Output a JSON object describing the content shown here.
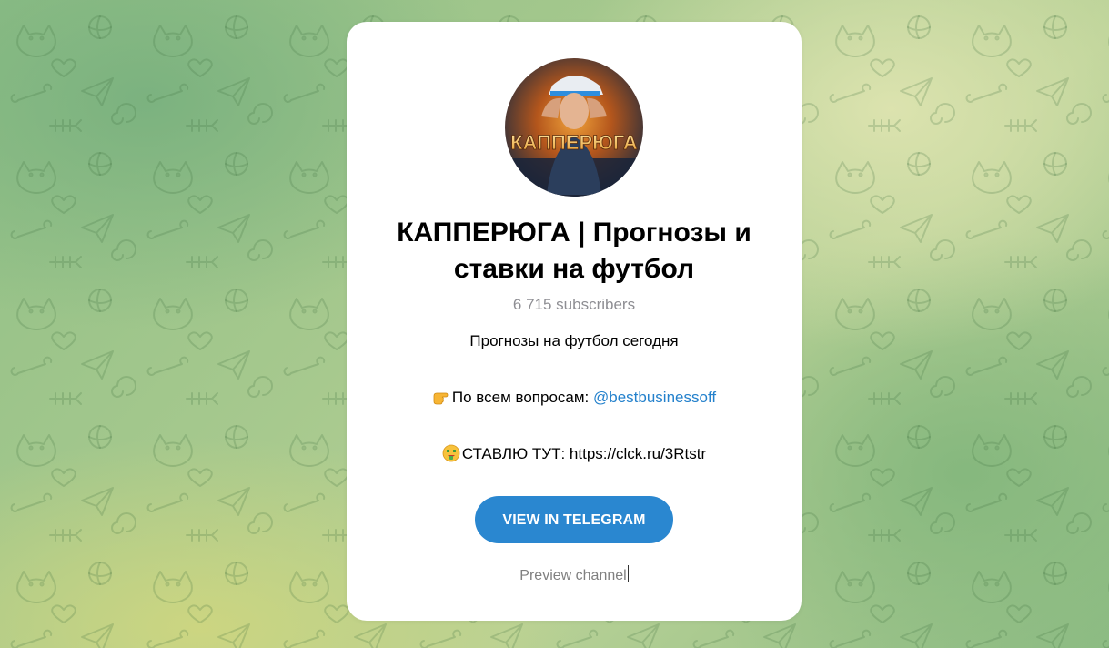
{
  "channel": {
    "title": "КАППЕРЮГА | Прогнозы и ставки на футбол",
    "subscribers": "6 715 subscribers",
    "avatar_text": "КАППЕРЮГА",
    "description": {
      "line1": "Прогнозы на футбол сегодня",
      "line2_emoji": "pointing-hand-icon",
      "line2_text": "По всем вопросам: ",
      "line2_link": "@bestbusinessoff",
      "line3_emoji": "money-mouth-face-icon",
      "line3_text": "СТАВЛЮ ТУТ: https://clck.ru/3Rtstr"
    }
  },
  "actions": {
    "view_button": "VIEW IN TELEGRAM",
    "preview_link": "Preview channel"
  },
  "colors": {
    "accent": "#2a87d0",
    "link": "#2481cc",
    "muted": "#8e8e93",
    "card": "#ffffff"
  }
}
